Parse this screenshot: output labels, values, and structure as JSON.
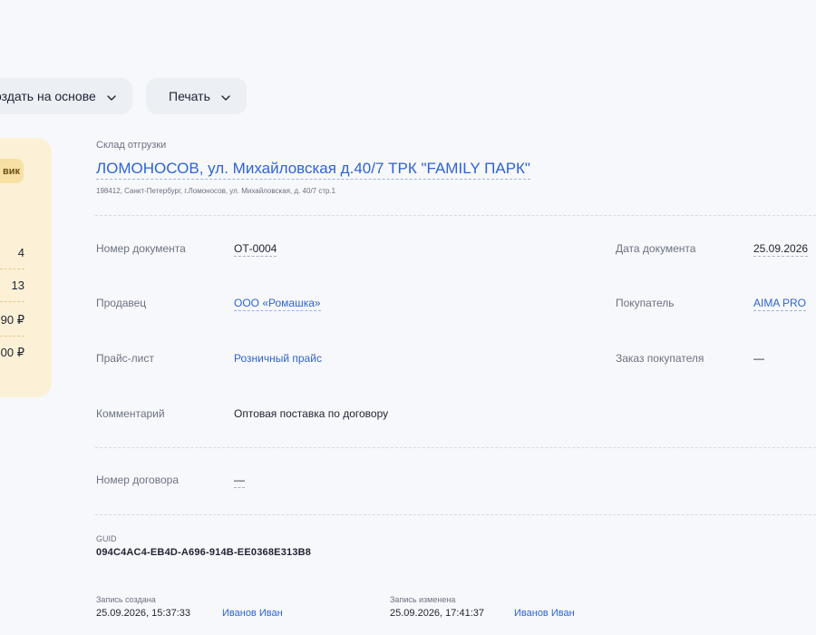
{
  "toolbar": {
    "create_based_label": "оздать на основе",
    "print_label": "Печать"
  },
  "summary": {
    "badge": "вик",
    "values": [
      "4",
      "13",
      "90 ₽",
      "00 ₽"
    ]
  },
  "warehouse": {
    "label": "Склад отгрузки",
    "name": "ЛОМОНОСОВ, ул. Михайловская д.40/7 ТРК \"FAMILY ПАРК\"",
    "address": "198412, Санкт-Петербург, г.Ломоносов, ул. Михайловская, д. 40/7 стр.1"
  },
  "fields": {
    "doc_number_label": "Номер документа",
    "doc_number": "ОТ-0004",
    "doc_date_label": "Дата документа",
    "doc_date": "25.09.2026",
    "seller_label": "Продавец",
    "seller": "ООО «Ромашка»",
    "buyer_label": "Покупатель",
    "buyer": "AIMA PRO",
    "price_list_label": "Прайс-лист",
    "price_list": "Розничный прайс",
    "order_label": "Заказ покупателя",
    "order": "—",
    "comment_label": "Комментарий",
    "comment": "Оптовая поставка по договору",
    "contract_label": "Номер договора",
    "contract": "—"
  },
  "guid": {
    "label": "GUID",
    "value": "094C4AC4-EB4D-A696-914B-EE0368E313B8"
  },
  "record": {
    "created_label": "Запись создана",
    "created_at": "25.09.2026, 15:37:33",
    "created_by": "Иванов Иван",
    "modified_label": "Запись изменена",
    "modified_at": "25.09.2026, 17:41:37",
    "modified_by": "Иванов Иван"
  }
}
